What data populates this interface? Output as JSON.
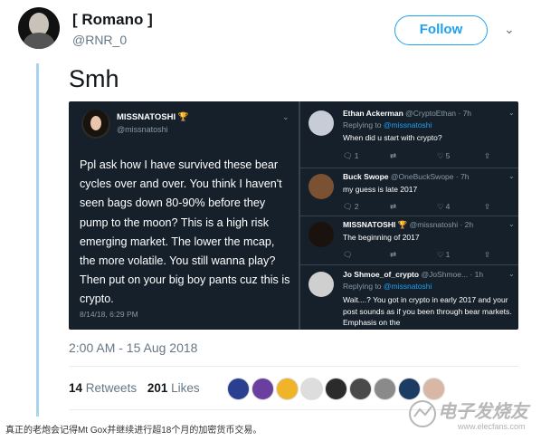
{
  "tweet": {
    "display_name": "[ Romano ]",
    "handle": "@RNR_0",
    "follow_label": "Follow",
    "text": "Smh",
    "timestamp": "2:00 AM - 15 Aug 2018",
    "retweets_count": "14",
    "retweets_label": "Retweets",
    "likes_count": "201",
    "likes_label": "Likes"
  },
  "embedded": {
    "main": {
      "name": "MISSNATOSHI",
      "handle": "@missnatoshi",
      "text": "Ppl ask how I have survived these bear cycles over and over. You think I haven't seen bags down 80-90% before they pump to the moon? This is a high risk emerging market. The lower the mcap, the more volatile. You still wanna play?Then put on your big boy pants cuz this is crypto.",
      "date": "8/14/18, 6:29 PM"
    },
    "replies": [
      {
        "name": "Ethan Ackerman",
        "handle": "@CryptoEthan · 7h",
        "replying_prefix": "Replying to",
        "replying_to": "@missnatoshi",
        "text": "When did u start with crypto?",
        "replies": "1",
        "likes": "5",
        "avatar_color": "#c7ccd6"
      },
      {
        "name": "Buck Swope",
        "handle": "@OneBuckSwope · 7h",
        "text": "my guess is late 2017",
        "replies": "2",
        "likes": "4",
        "avatar_color": "#7a5233"
      },
      {
        "name": "MISSNATOSHI",
        "handle": "@missnatoshi · 2h",
        "text": "The beginning of 2017",
        "replies": "",
        "likes": "1",
        "avatar_color": "#1a120d"
      },
      {
        "name": "Jo Shmoe_of_crypto",
        "handle": "@JoShmoe... · 1h",
        "replying_prefix": "Replying to",
        "replying_to": "@missnatoshi",
        "text": "Wait....? You got in crypto in early 2017 and your post sounds as if you been through bear markets. Emphasis on the",
        "avatar_color": "#cfcfcf"
      }
    ]
  },
  "icons": {
    "caret": "chevron-down-icon",
    "reply": "reply-icon",
    "retweet": "retweet-icon",
    "like": "heart-icon",
    "share": "share-icon",
    "trophy": "trophy-emoji-icon"
  },
  "likers": [
    "#2a3f8f",
    "#6b3fa0",
    "#f0b428",
    "#dddddd",
    "#2b2b2b",
    "#4a4a4a",
    "#8a8a8a",
    "#1c3c64",
    "#d9b7a5"
  ],
  "caption": "真正的老炮会记得Mt Gox并继续进行超18个月的加密货币交易。",
  "watermark": {
    "text": "电子发烧友",
    "url": "www.elecfans.com"
  },
  "colors": {
    "accent": "#1da1f2",
    "embed_bg": "#15202b"
  }
}
